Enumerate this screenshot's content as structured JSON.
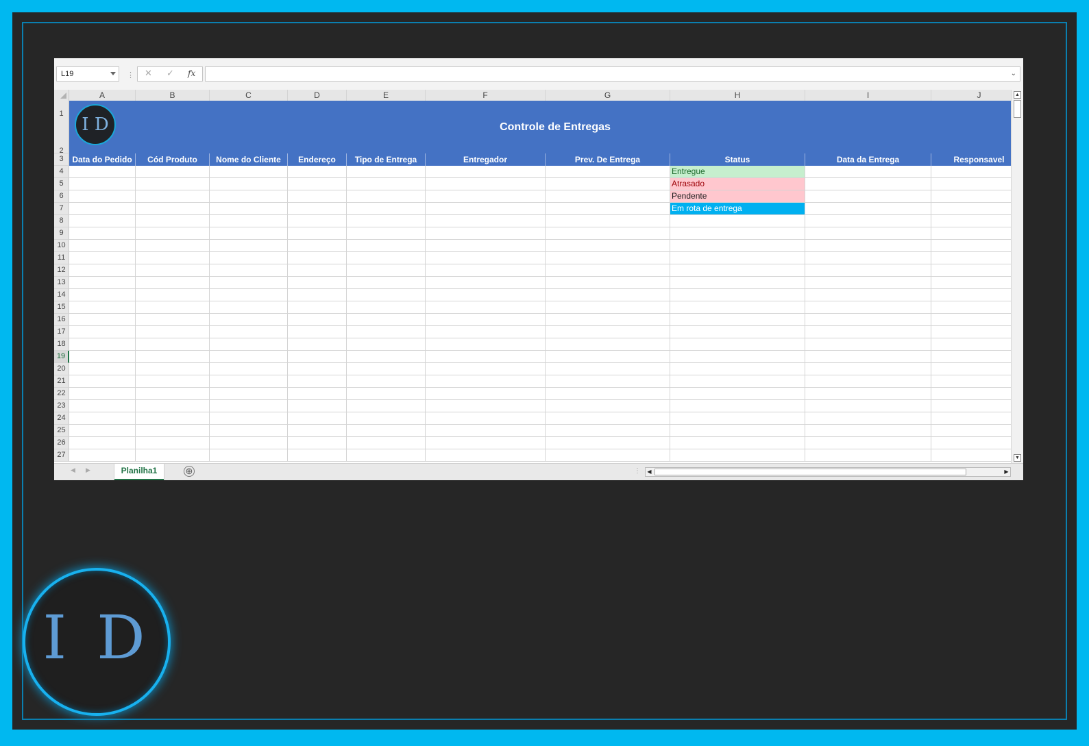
{
  "namebox": "L19",
  "formula_bar": {
    "fx": "fx",
    "cancel": "✕",
    "enter": "✓",
    "value": ""
  },
  "columns": [
    {
      "letter": "A"
    },
    {
      "letter": "B"
    },
    {
      "letter": "C"
    },
    {
      "letter": "D"
    },
    {
      "letter": "E"
    },
    {
      "letter": "F"
    },
    {
      "letter": "G"
    },
    {
      "letter": "H"
    },
    {
      "letter": "I"
    },
    {
      "letter": "J"
    }
  ],
  "rows": [
    "1",
    "2",
    "3",
    "4",
    "5",
    "6",
    "7",
    "8",
    "9",
    "10",
    "11",
    "12",
    "13",
    "14",
    "15",
    "16",
    "17",
    "18",
    "19",
    "20",
    "21",
    "22",
    "23",
    "24",
    "25",
    "26",
    "27"
  ],
  "selected_row": "19",
  "banner": {
    "title": "Controle de Entregas",
    "logo_text": "I D"
  },
  "headers": [
    "Data do Pedido",
    "Cód Produto",
    "Nome do Cliente",
    "Endereço",
    "Tipo de Entrega",
    "Entregador",
    "Prev. De Entrega",
    "Status",
    "Data da Entrega",
    "Responsavel"
  ],
  "status_values": [
    {
      "label": "Entregue",
      "style": "entregue"
    },
    {
      "label": "Atrasado",
      "style": "atrasado"
    },
    {
      "label": "Pendente",
      "style": "pendente"
    },
    {
      "label": "Em rota de entrega",
      "style": "rota"
    }
  ],
  "colors": {
    "frame": "#00b8f0",
    "background": "#262626",
    "header_blue": "#4472c4",
    "entregue_bg": "#c6efce",
    "atrasado_bg": "#ffc7ce",
    "rota_bg": "#00b0f0"
  },
  "sheet_tabs": [
    "Planilha1"
  ],
  "add_sheet_icon": "⊕",
  "logo_big_text": "I D"
}
